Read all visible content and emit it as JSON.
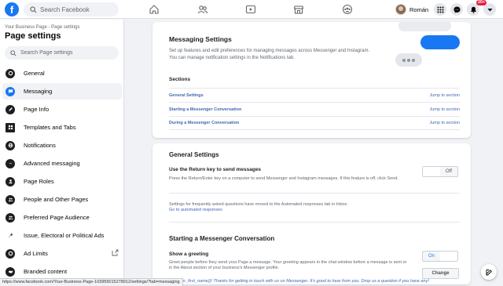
{
  "topbar": {
    "search_placeholder": "Search Facebook",
    "profile_name": "Román",
    "notifications_badge": "20+"
  },
  "sidebar": {
    "breadcrumb": "Your Business Page - Page settings",
    "title": "Page settings",
    "search_placeholder": "Search Page settings",
    "items": [
      {
        "label": "General",
        "icon": "gear-icon"
      },
      {
        "label": "Messaging",
        "icon": "chat-bubble-icon"
      },
      {
        "label": "Page Info",
        "icon": "pencil-icon"
      },
      {
        "label": "Templates and Tabs",
        "icon": "grid-icon"
      },
      {
        "label": "Notifications",
        "icon": "globe-icon"
      },
      {
        "label": "Advanced messaging",
        "icon": "messenger-icon"
      },
      {
        "label": "Page Roles",
        "icon": "person-icon"
      },
      {
        "label": "People and Other Pages",
        "icon": "people-icon"
      },
      {
        "label": "Preferred Page Audience",
        "icon": "people-icon"
      },
      {
        "label": "Issue, Electoral or Political Ads",
        "icon": "wrench-icon"
      },
      {
        "label": "Ad Limits",
        "icon": "gear-icon"
      },
      {
        "label": "Branded content",
        "icon": "handshake-icon"
      }
    ]
  },
  "status_url": "https://www.facebook.com/Your-Business-Page-103955015278912/settings/?tab=messaging",
  "messaging_settings": {
    "title": "Messaging Settings",
    "description_line1": "Set up features and edit preferences for managing messages across Messenger and Instagram.",
    "description_line2": "You can manage notification settings in the Notifications tab.",
    "sections_label": "Sections",
    "sections": [
      {
        "label": "General Settings",
        "jump": "Jump to section"
      },
      {
        "label": "Starting a Messenger Conversation",
        "jump": "Jump to section"
      },
      {
        "label": "During a Messenger Conversation",
        "jump": "Jump to section"
      }
    ]
  },
  "general_settings": {
    "title": "General Settings",
    "return_key_label": "Use the Return key to send messages",
    "return_key_desc": "Press the Return/Enter key on a computer to send Messenger and Instagram messages. If this feature is off, click Send.",
    "return_key_toggle": "Off",
    "moved_note": "Settings for frequently asked questions have moved to the Automated responses tab in Inbox.",
    "moved_link": "Go to automated responses"
  },
  "starting_conversation": {
    "title": "Starting a Messenger Conversation",
    "greeting_label": "Show a greeting",
    "greeting_desc_line1": "Greet people before they send your Page a message. Your greeting appears in the chat window before a message is sent or",
    "greeting_desc_line2": "in the About section of your business's Messenger profile.",
    "greeting_toggle": "On",
    "change_button": "Change",
    "greeting_text": "Hi {{user_first_name}}! Thanks for getting in touch with us on Messenger. It's good to hear from you. Drop us a question if you have any!"
  },
  "colors": {
    "brand": "#1877f2",
    "link": "#4267b2"
  }
}
